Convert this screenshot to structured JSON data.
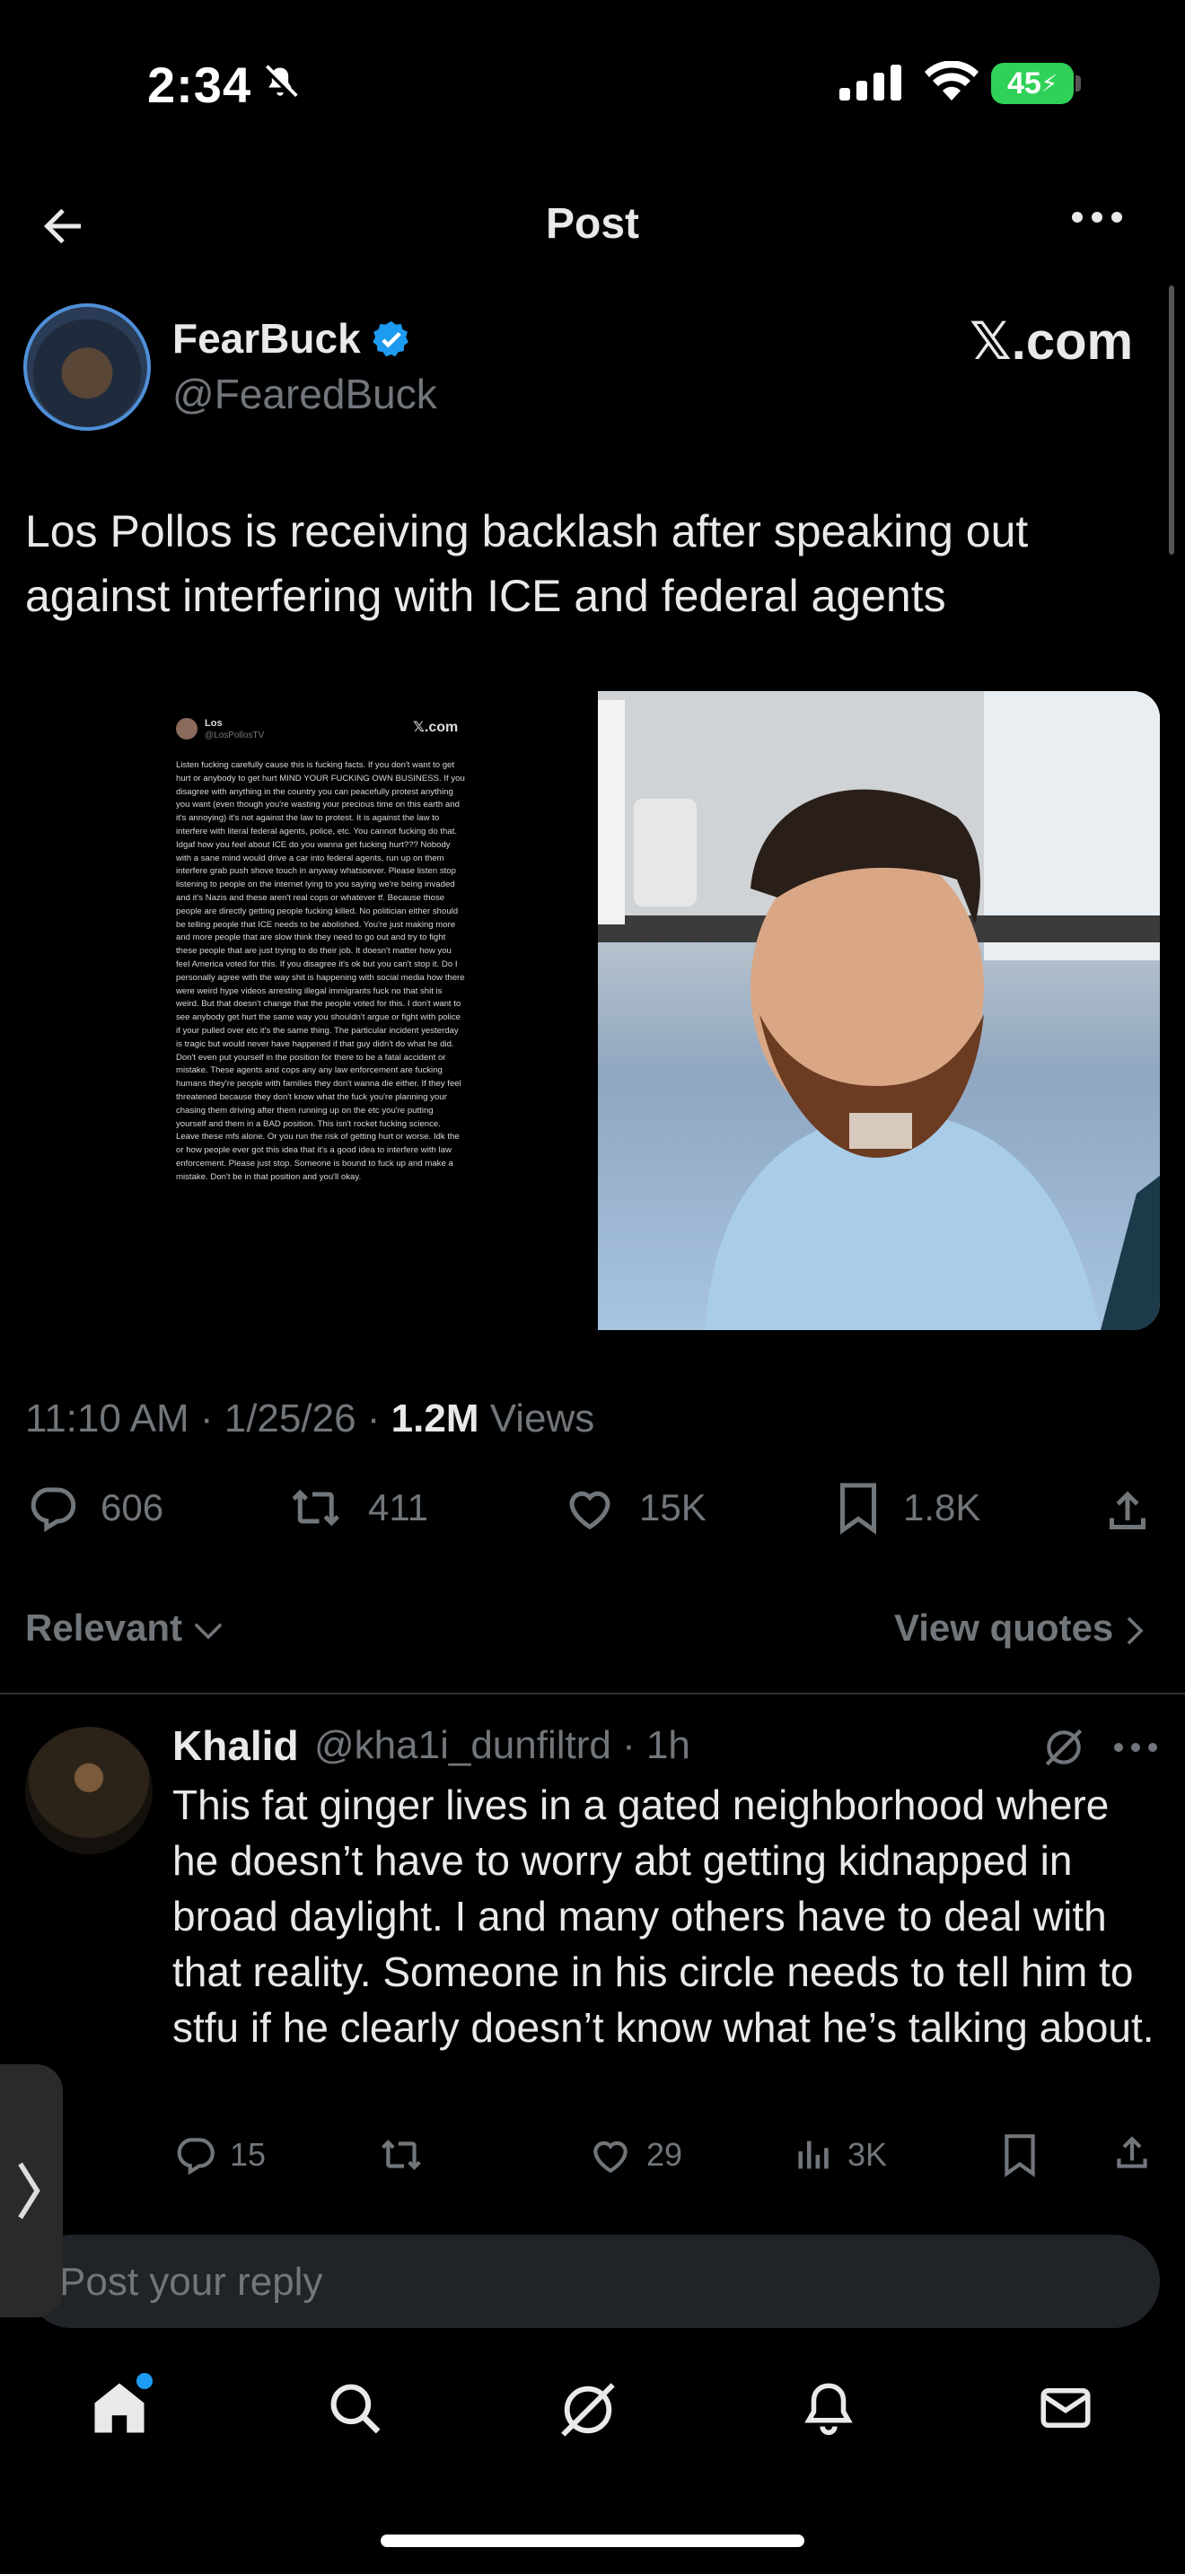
{
  "status_bar": {
    "time": "2:34",
    "battery": "45"
  },
  "header": {
    "title": "Post"
  },
  "author": {
    "name": "FearBuck",
    "handle": "@FearedBuck",
    "watermark": "𝕏.com"
  },
  "post": {
    "text": "Los Pollos is receiving backlash after speaking out against interfering with ICE and federal agents",
    "embedded": {
      "name": "Los",
      "handle": "@LosPollosTV",
      "watermark": "𝕏.com",
      "text": "Listen fucking carefully cause this is fucking facts. If you don't want to get hurt or anybody to get hurt MIND YOUR FUCKING OWN BUSINESS. If you disagree with anything in the country you can peacefully protest anything you want (even though you're wasting your precious time on this earth and it's annoying) it's not against the law to protest. It is against the law to interfere with literal federal agents, police, etc. You cannot fucking do that. Idgaf how you feel about ICE do you wanna get fucking hurt??? Nobody with a sane mind would drive a car into federal agents, run up on them interfere grab push shove touch in anyway whatsoever. Please listen stop listening to people on the internet lying to you saying we're being invaded and it's Nazis and these aren't real cops or whatever tf. Because those people are directly getting people fucking killed. No politician either should be telling people that ICE needs to be abolished. You're just making more and more people that are slow think they need to go out and try to fight these people that are just trying to do their job. It doesn't matter how you feel America voted for this. If you disagree it's ok but you can't stop it. Do I personally agree with the way shit is happening with social media how there were weird hype videos arresting illegal immigrants fuck no that shit is weird. But that doesn't change that the people voted for this. I don't want to see anybody get hurt the same way you shouldn't argue or fight with police if your pulled over etc it's the same thing. The particular incident yesterday is tragic but would never have happened if that guy didn't do what he did. Don't even put yourself in the position for there to be a fatal accident or mistake. These agents and cops any any law enforcement are fucking humans they're people with families they don't wanna die either. If they feel threatened because they don't know what the fuck you're planning your chasing them driving after them running up on the etc you're putting yourself and them in a BAD position. This isn't rocket fucking science. Leave these mfs alone. Or you run the risk of getting hurt or worse. Idk the or how people ever got this idea that it's a good idea to interfere with law enforcement. Please just stop. Someone is bound to fuck up and make a mistake. Don't be in that position and you'll okay."
    },
    "meta_prefix": "11:10 AM · 1/25/26 · ",
    "views_count": "1.2M",
    "views_label": " Views",
    "actions": {
      "replies": "606",
      "reposts": "411",
      "likes": "15K",
      "bookmarks": "1.8K"
    }
  },
  "filters": {
    "relevant": "Relevant",
    "view_quotes": "View quotes"
  },
  "reply": {
    "name": "Khalid",
    "handle_time": "@kha1i_dunfiltrd · 1h",
    "text": "This fat ginger lives in a gated neighborhood where he doesn’t have to worry abt getting kidnapped in broad daylight. I and many others have to deal with that reality. Someone in his circle needs to tell him to stfu if he clearly doesn’t know what he’s talking about.",
    "actions": {
      "replies": "15",
      "likes": "29",
      "views": "3K"
    }
  },
  "composer": {
    "placeholder": "Post your reply"
  },
  "icons": [
    "back-arrow-icon",
    "more-icon",
    "verified-badge-icon",
    "reply-icon",
    "repost-icon",
    "like-icon",
    "bookmark-icon",
    "share-icon",
    "views-icon",
    "grok-icon",
    "home-icon",
    "search-icon",
    "notifications-icon",
    "messages-icon",
    "chevron-down-icon",
    "chevron-right-icon"
  ]
}
